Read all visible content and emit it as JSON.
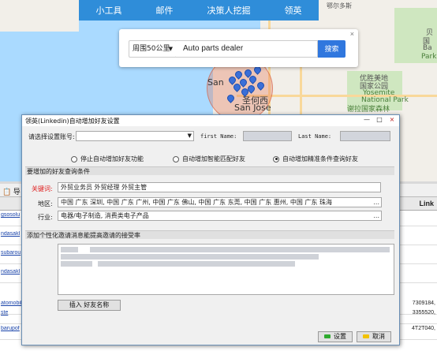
{
  "top_nav": {
    "items": [
      "小工具",
      "邮件",
      "决策人挖掘",
      "领英"
    ]
  },
  "map": {
    "attribution": "鄂尔多斯",
    "labels": [
      "San",
      "San Jose",
      "圣何西",
      "优胜美地",
      "国家公园",
      "Yosemite",
      "National Park",
      "谢拉国家森林",
      "贝",
      "国",
      "Ba",
      "Park"
    ]
  },
  "search": {
    "radius_value": "周围50公里",
    "keyword_value": "Auto parts dealer",
    "search_label": "搜索",
    "close_glyph": "×"
  },
  "background_table": {
    "toolbar_label": "导",
    "link_header": "Link",
    "rows": [
      {
        "left": "gsosolu",
        "right": ""
      },
      {
        "left": "ndasakl",
        "right": ""
      },
      {
        "left": "subarou",
        "right": ""
      },
      {
        "left": "ndasakl",
        "right": ""
      },
      {
        "left": "atomobile",
        "right": "7309184,"
      },
      {
        "left": "ste",
        "right": "3355520,"
      },
      {
        "left": "barupof",
        "right": "4T2T040,"
      }
    ]
  },
  "dialog": {
    "title": "领英(Linkedin)自动增加好友设置",
    "minimize": "—",
    "maximize": "□",
    "close": "×",
    "account_label": "请选择设置账号:",
    "first_name_label": "first Name:",
    "last_name_label": "Last Name:",
    "radios": [
      {
        "label": "停止自动增加好友功能",
        "checked": false
      },
      {
        "label": "自动增加智能匹配好友",
        "checked": false
      },
      {
        "label": "自动增加精准条件查询好友",
        "checked": true
      }
    ],
    "section_conditions": "要增加的好友查询条件",
    "keyword_label": "关键词:",
    "keyword_value": "外贸业务员 外贸经理 外贸主管",
    "region_label": "地区:",
    "region_value": "中国 广东 深圳, 中国 广东 广州, 中国 广东 佛山, 中国 广东 东莞, 中国 广东 惠州, 中国 广东 珠海",
    "industry_label": "行业:",
    "industry_value": "电器/电子制造, 消费类电子产品",
    "more_glyph": "...",
    "section_message": "添加个性化邀请消息能提高邀请的接受率",
    "message_text": "",
    "insert_button": "插入 好友名称",
    "ok_button": "设置",
    "cancel_button": "取消"
  },
  "colors": {
    "nav_blue": "#2f8dd9",
    "search_blue": "#3077de",
    "keyword_label_red": "#e02020",
    "ok_icon_green": "#2eaa2e",
    "cancel_icon_yellow": "#f2c200"
  }
}
